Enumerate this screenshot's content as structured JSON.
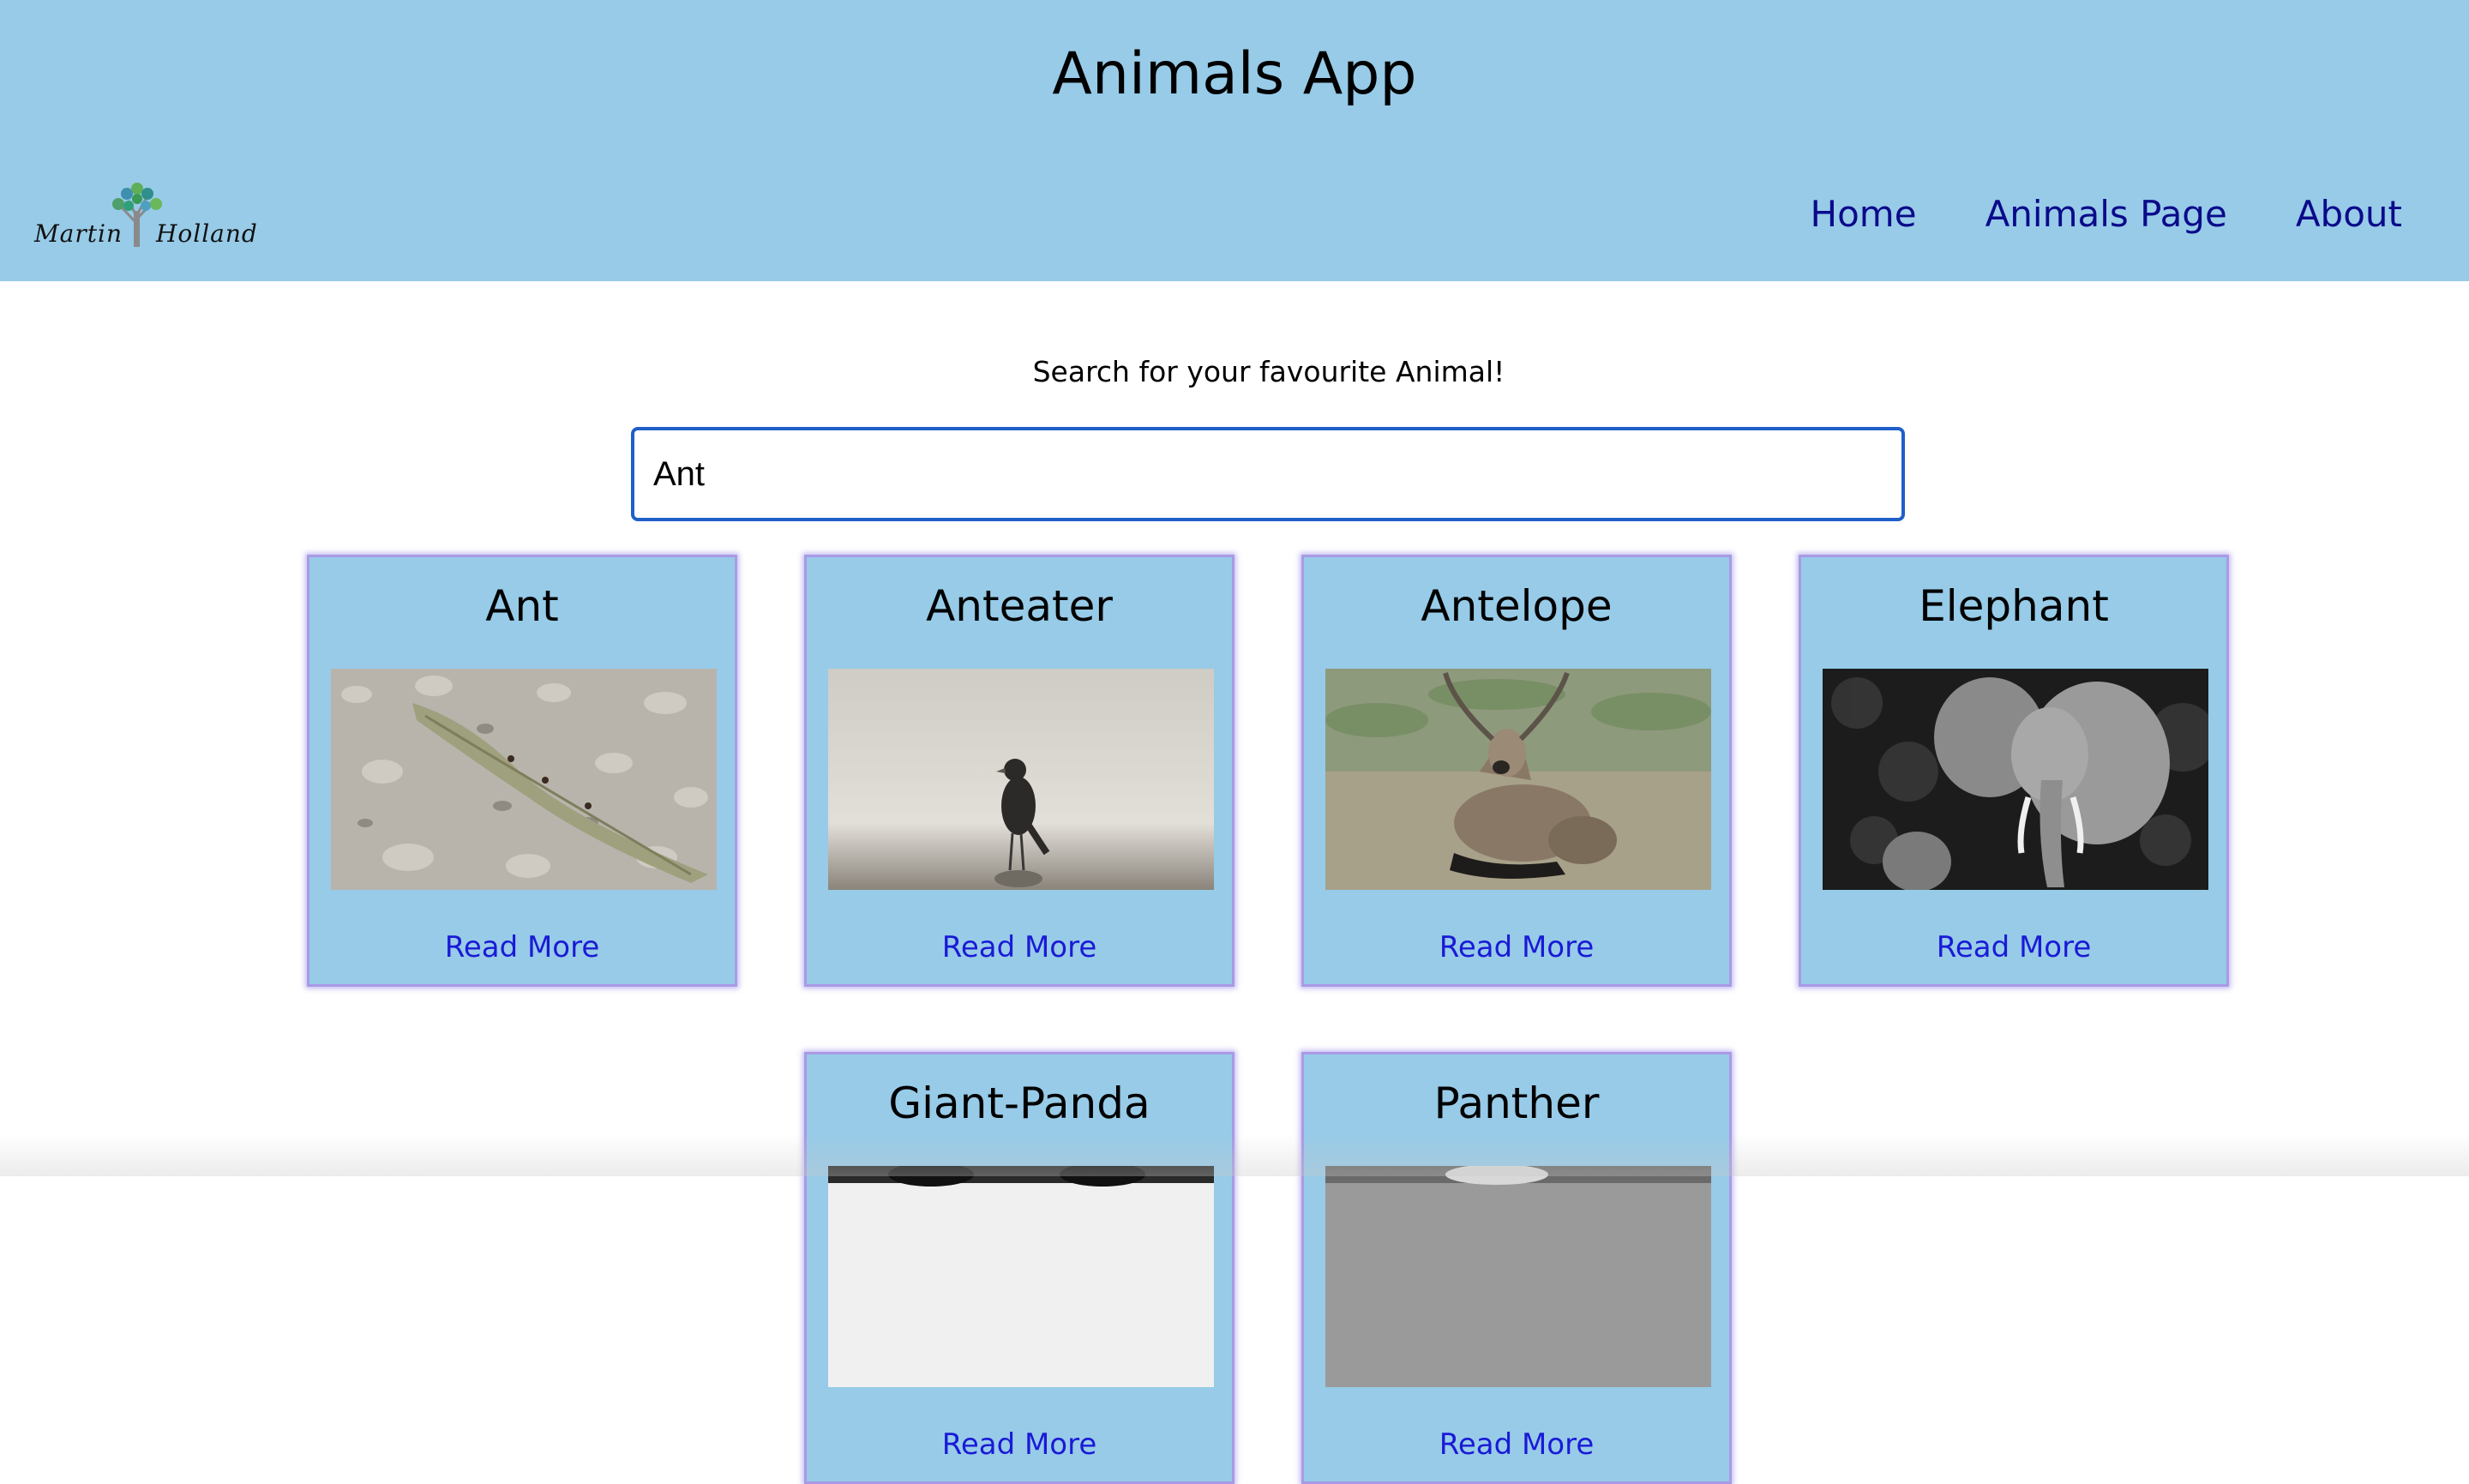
{
  "header": {
    "title": "Animals App",
    "logo": {
      "left_word": "Martin",
      "right_word": "Holland"
    },
    "nav": [
      {
        "label": "Home"
      },
      {
        "label": "Animals Page"
      },
      {
        "label": "About"
      }
    ]
  },
  "search": {
    "label": "Search for your favourite Animal!",
    "value": "Ant"
  },
  "cards": [
    {
      "name": "Ant",
      "link": "Read More"
    },
    {
      "name": "Anteater",
      "link": "Read More"
    },
    {
      "name": "Antelope",
      "link": "Read More"
    },
    {
      "name": "Elephant",
      "link": "Read More"
    },
    {
      "name": "Giant-Panda",
      "link": "Read More"
    },
    {
      "name": "Panther",
      "link": "Read More"
    }
  ],
  "colors": {
    "header_bg": "#97cbe8",
    "card_bg": "#97cbe8",
    "nav_link": "#0a0a8a",
    "read_more": "#1a1ad6",
    "search_border": "#1f5fc8"
  }
}
